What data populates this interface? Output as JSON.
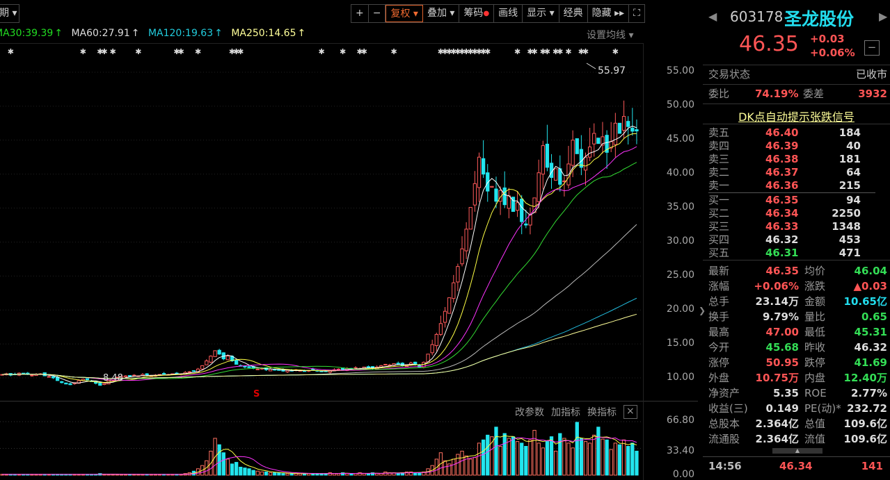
{
  "toolbar": {
    "period": "期",
    "buttons": [
      "+",
      "−",
      "复权",
      "叠加",
      "筹码",
      "画线",
      "显示",
      "经典",
      "隐藏"
    ],
    "active": "复权"
  },
  "ma_legend": [
    {
      "label": "MA30:39.39",
      "color": "#22dd22"
    },
    {
      "label": "MA60:27.91",
      "color": "#dddddd"
    },
    {
      "label": "MA120:19.63",
      "color": "#22ccdd"
    },
    {
      "label": "MA250:14.65",
      "color": "#ffff99"
    }
  ],
  "set_ma": "设置均线",
  "price_axis": [
    "55.00",
    "50.00",
    "45.00",
    "40.00",
    "35.00",
    "30.00",
    "25.00",
    "20.00",
    "15.00",
    "10.00"
  ],
  "vol_axis": [
    "66.80",
    "33.40",
    "0.00"
  ],
  "high_label": "55.97",
  "low_label": "8.48",
  "signal_s": "S",
  "vol_header": {
    "edit": "改参数",
    "add": "加指标",
    "swap": "换指标",
    "close": "×"
  },
  "chart_data": {
    "type": "candlestick",
    "ylim": [
      10,
      55
    ],
    "vol_ylim": [
      0,
      66.8
    ],
    "closes": [
      10.5,
      10.6,
      10.4,
      10.5,
      10.7,
      10.6,
      10.5,
      10.4,
      10.5,
      10.6,
      10.3,
      10.2,
      10.0,
      9.6,
      9.3,
      9.1,
      9.0,
      9.3,
      9.6,
      9.8,
      9.7,
      9.5,
      9.2,
      8.9,
      9.2,
      9.6,
      9.9,
      10.1,
      10.2,
      10.3,
      10.2,
      10.4,
      10.3,
      10.5,
      10.4,
      10.3,
      10.4,
      10.5,
      10.6,
      10.5,
      10.6,
      10.7,
      10.6,
      10.8,
      10.9,
      11.0,
      11.3,
      11.8,
      12.5,
      13.2,
      14.0,
      13.5,
      12.8,
      13.2,
      12.5,
      12.0,
      11.8,
      11.6,
      11.5,
      11.4,
      11.3,
      11.4,
      11.2,
      11.3,
      11.2,
      11.1,
      11.0,
      11.1,
      11.0,
      11.2,
      11.1,
      11.0,
      11.1,
      11.2,
      11.0,
      10.9,
      11.0,
      11.1,
      11.2,
      11.3,
      11.2,
      11.4,
      11.3,
      11.5,
      11.4,
      11.6,
      11.5,
      11.4,
      11.6,
      11.8,
      12.0,
      11.9,
      12.1,
      12.0,
      11.8,
      11.9,
      12.2,
      12.0,
      11.6,
      12.3,
      13.5,
      14.9,
      16.4,
      18.0,
      19.8,
      21.8,
      24.0,
      26.4,
      29.0,
      31.9,
      35.1,
      38.6,
      42.5,
      40.0,
      37.5,
      38.2,
      36.0,
      37.6,
      35.5,
      36.8,
      34.5,
      35.8,
      33.0,
      32.5,
      34.0,
      36.5,
      40.2,
      44.2,
      41.0,
      39.5,
      40.8,
      38.5,
      39.0,
      41.5,
      45.0,
      43.0,
      41.0,
      42.5,
      44.0,
      46.0,
      44.5,
      45.5,
      43.2,
      44.8,
      47.5,
      46.0,
      48.5,
      47.0,
      46.32,
      46.35
    ],
    "volumes": [
      1,
      1,
      1,
      1,
      1,
      1,
      1,
      1,
      1,
      1,
      1,
      1,
      1,
      1,
      1,
      1,
      1,
      1,
      1,
      1,
      1,
      1,
      1,
      2,
      1,
      1,
      1,
      1,
      1,
      1,
      1,
      1,
      1,
      1,
      1,
      1,
      1,
      1,
      1,
      1,
      1,
      1,
      1,
      2,
      3,
      5,
      8,
      12,
      18,
      30,
      46,
      38,
      28,
      20,
      14,
      16,
      10,
      9,
      8,
      6,
      5,
      4,
      4,
      3,
      3,
      3,
      2,
      2,
      2,
      2,
      2,
      2,
      2,
      2,
      2,
      2,
      2,
      3,
      2,
      2,
      3,
      2,
      2,
      2,
      3,
      2,
      2,
      3,
      2,
      2,
      4,
      3,
      3,
      2,
      3,
      4,
      4,
      3,
      3,
      4,
      8,
      12,
      20,
      28,
      18,
      14,
      20,
      26,
      30,
      24,
      20,
      22,
      40,
      44,
      50,
      48,
      60,
      36,
      52,
      46,
      48,
      42,
      40,
      36,
      44,
      56,
      40,
      34,
      42,
      48,
      30,
      52,
      46,
      40,
      34,
      66,
      46,
      42,
      40,
      50,
      60,
      45,
      44,
      32,
      40,
      38,
      44,
      36,
      40,
      30
    ],
    "signals": [
      2,
      19,
      23,
      24,
      26,
      32,
      41,
      42,
      46,
      54,
      55,
      56,
      75,
      80,
      84,
      85,
      92,
      103,
      104,
      105,
      106,
      107,
      108,
      109,
      110,
      111,
      112,
      113,
      114,
      121,
      124,
      125,
      127,
      128,
      130,
      131,
      133,
      136,
      137,
      144
    ]
  },
  "quote": {
    "code": "603178",
    "name": "圣龙股份",
    "price": "46.35",
    "change": "+0.03",
    "pct": "+0.06%",
    "status_label": "交易状态",
    "status": "已收市",
    "wb_label": "委比",
    "wb": "74.19%",
    "wc_label": "委差",
    "wc": "3932",
    "dk": "DK点自动提示张跌信号",
    "sells": [
      {
        "l": "卖五",
        "p": "46.40",
        "v": "184"
      },
      {
        "l": "卖四",
        "p": "46.39",
        "v": "40"
      },
      {
        "l": "卖三",
        "p": "46.38",
        "v": "181"
      },
      {
        "l": "卖二",
        "p": "46.37",
        "v": "64"
      },
      {
        "l": "卖一",
        "p": "46.36",
        "v": "215"
      }
    ],
    "buys": [
      {
        "l": "买一",
        "p": "46.35",
        "v": "94",
        "c": "r"
      },
      {
        "l": "买二",
        "p": "46.34",
        "v": "2250",
        "c": "r"
      },
      {
        "l": "买三",
        "p": "46.33",
        "v": "1348",
        "c": "r"
      },
      {
        "l": "买四",
        "p": "46.32",
        "v": "453",
        "c": "w"
      },
      {
        "l": "买五",
        "p": "46.31",
        "v": "471",
        "c": "g"
      }
    ],
    "stats": [
      [
        "最新",
        "46.35",
        "r",
        "均价",
        "46.04",
        "g"
      ],
      [
        "涨幅",
        "+0.06%",
        "r",
        "涨跌",
        "▲0.03",
        "r"
      ],
      [
        "总手",
        "23.14万",
        "w",
        "金额",
        "10.65亿",
        "c"
      ],
      [
        "换手",
        "9.79%",
        "w",
        "量比",
        "0.65",
        "g"
      ],
      [
        "最高",
        "47.00",
        "r",
        "最低",
        "45.31",
        "g"
      ],
      [
        "今开",
        "45.68",
        "g",
        "昨收",
        "46.32",
        "w"
      ],
      [
        "涨停",
        "50.95",
        "r",
        "跌停",
        "41.69",
        "g"
      ],
      [
        "外盘",
        "10.75万",
        "r",
        "内盘",
        "12.40万",
        "g"
      ],
      [
        "净资产",
        "5.35",
        "w",
        "ROE",
        "2.77%",
        "w"
      ],
      [
        "收益(三)",
        "0.149",
        "w",
        "PE(动)*",
        "232.72",
        "w"
      ],
      [
        "总股本",
        "2.364亿",
        "w",
        "总值",
        "109.6亿",
        "w"
      ],
      [
        "流通股",
        "2.364亿",
        "w",
        "流值",
        "109.6亿",
        "w"
      ]
    ],
    "tick": {
      "time": "14:56",
      "price": "46.34",
      "vol": "141"
    }
  }
}
